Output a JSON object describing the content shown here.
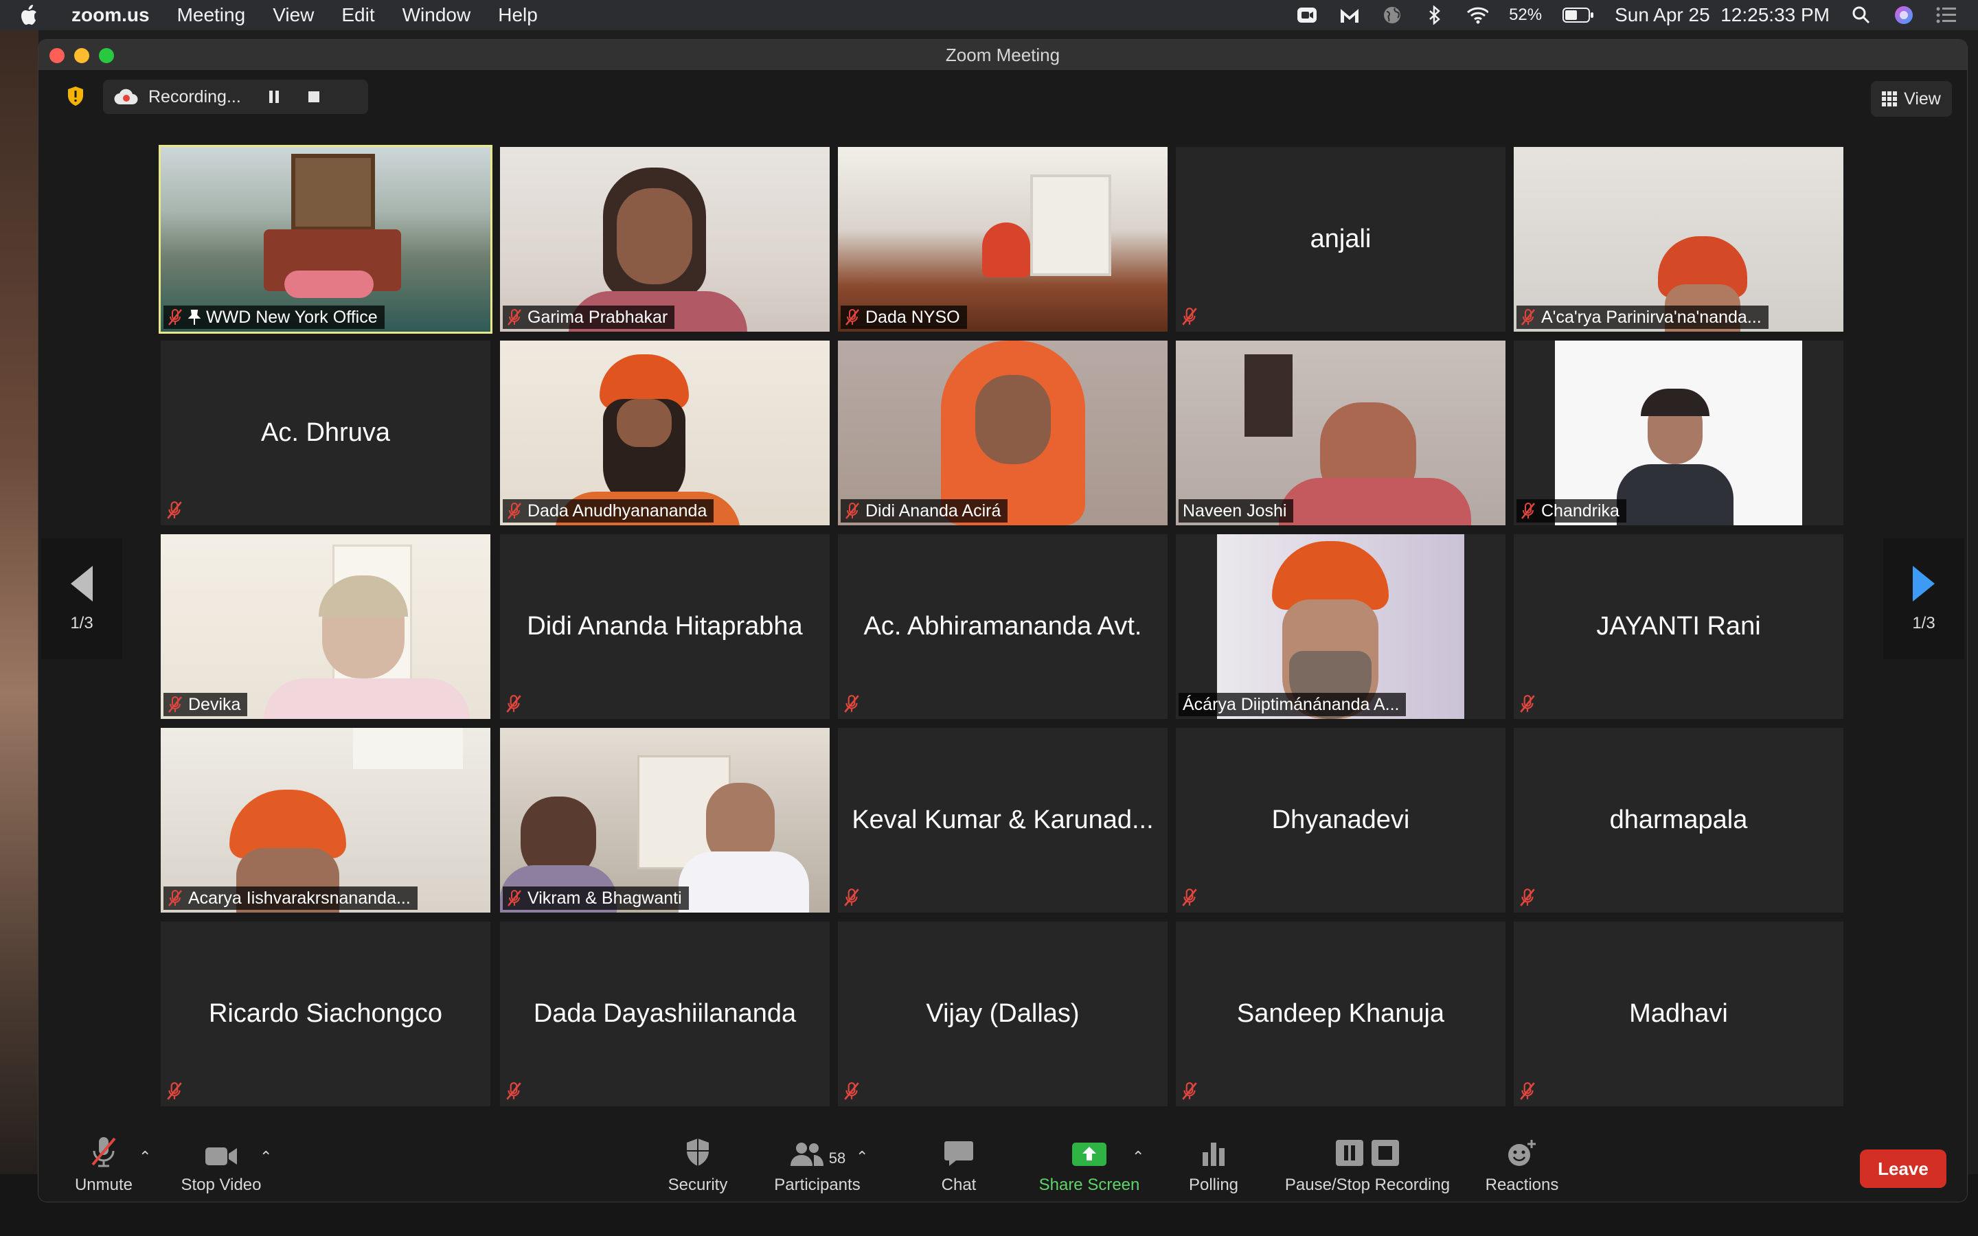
{
  "menubar": {
    "app_name": "zoom.us",
    "menus": [
      "Meeting",
      "View",
      "Edit",
      "Window",
      "Help"
    ],
    "battery": "52%",
    "datetime": "Sun Apr 25  12:25:33 PM"
  },
  "window": {
    "title": "Zoom Meeting"
  },
  "recording": {
    "label": "Recording..."
  },
  "view_button": {
    "label": "View"
  },
  "pagination": {
    "left": "1/3",
    "right": "1/3"
  },
  "participants": [
    {
      "name": "WWD New York Office",
      "video": true,
      "muted": true,
      "pinned": true,
      "active": true
    },
    {
      "name": "Garima Prabhakar",
      "video": true,
      "muted": true
    },
    {
      "name": "Dada NYSO",
      "video": true,
      "muted": true
    },
    {
      "name": "anjali",
      "video": false,
      "muted": true
    },
    {
      "name": "A'ca'rya Parinirva'na'nanda...",
      "video": true,
      "muted": true
    },
    {
      "name": "Ac. Dhruva",
      "video": false,
      "muted": true
    },
    {
      "name": "Dada Anudhyanananda",
      "video": true,
      "muted": true
    },
    {
      "name": "Didi Ananda Acirá",
      "video": true,
      "muted": true
    },
    {
      "name": "Naveen Joshi",
      "video": true,
      "muted": false
    },
    {
      "name": "Chandrika",
      "video": true,
      "muted": true
    },
    {
      "name": "Devika",
      "video": true,
      "muted": true
    },
    {
      "name": "Didi Ananda Hitaprabha",
      "video": false,
      "muted": true
    },
    {
      "name": "Ac. Abhiramananda Avt.",
      "video": false,
      "muted": true
    },
    {
      "name": "Ácárya Diiptimánánanda A...",
      "video": true,
      "muted": false
    },
    {
      "name": "JAYANTI Rani",
      "video": false,
      "muted": true
    },
    {
      "name": "Acarya Iishvarakrsnananda...",
      "video": true,
      "muted": true
    },
    {
      "name": "Vikram & Bhagwanti",
      "video": true,
      "muted": true
    },
    {
      "name": "Keval Kumar & Karunad...",
      "video": false,
      "muted": true
    },
    {
      "name": "Dhyanadevi",
      "video": false,
      "muted": true
    },
    {
      "name": "dharmapala",
      "video": false,
      "muted": true
    },
    {
      "name": "Ricardo Siachongco",
      "video": false,
      "muted": true
    },
    {
      "name": "Dada Dayashiilananda",
      "video": false,
      "muted": true
    },
    {
      "name": "Vijay (Dallas)",
      "video": false,
      "muted": true
    },
    {
      "name": "Sandeep Khanuja",
      "video": false,
      "muted": true
    },
    {
      "name": "Madhavi",
      "video": false,
      "muted": true
    }
  ],
  "toolbar": {
    "unmute": "Unmute",
    "stop_video": "Stop Video",
    "security": "Security",
    "participants": "Participants",
    "participant_count": "58",
    "chat": "Chat",
    "share_screen": "Share Screen",
    "polling": "Polling",
    "pause_stop_recording": "Pause/Stop Recording",
    "reactions": "Reactions",
    "leave": "Leave"
  },
  "colors": {
    "leave": "#d42f25",
    "share_screen": "#5dd36a",
    "active_speaker_border": "#e8e78a",
    "muted_mic": "#e0463e"
  }
}
